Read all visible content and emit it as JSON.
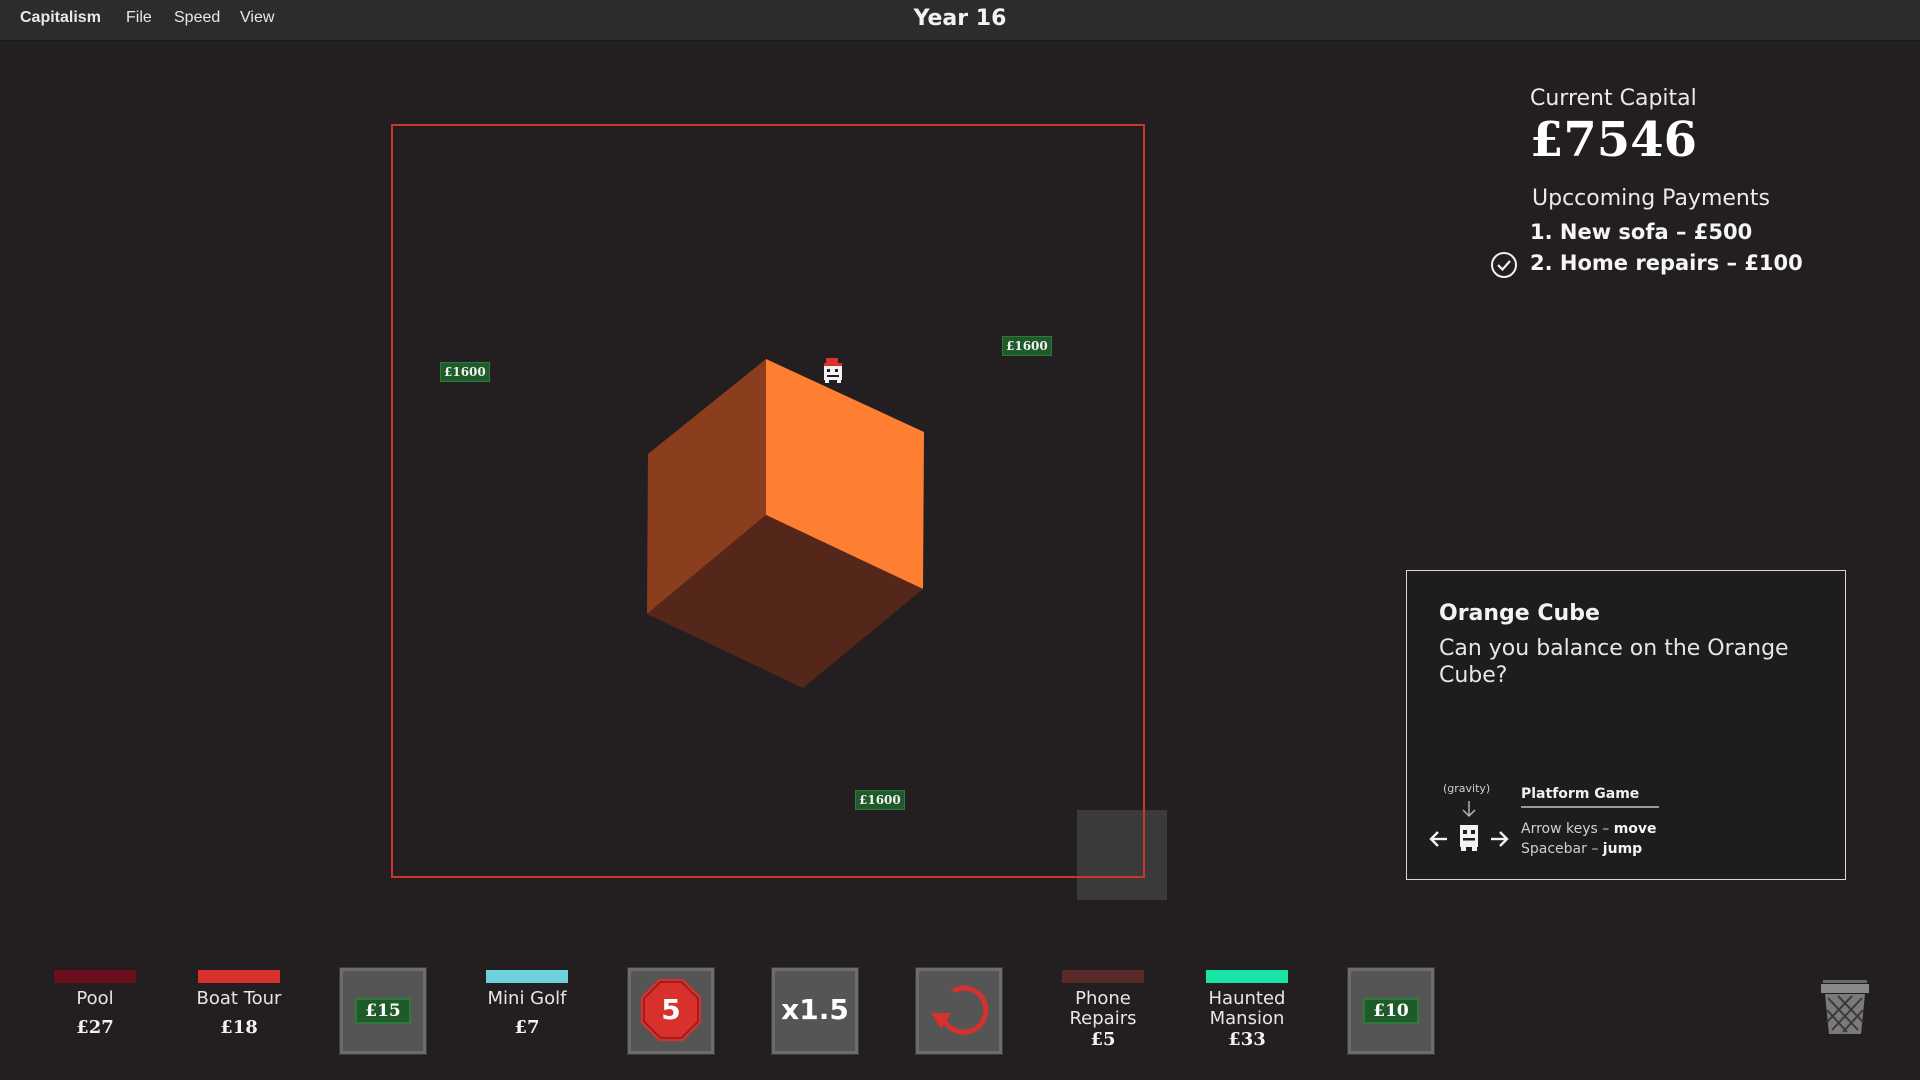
{
  "menu": {
    "app": "Capitalism",
    "file": "File",
    "speed": "Speed",
    "view": "View"
  },
  "header": {
    "year": "Year 16"
  },
  "game": {
    "coins": [
      "£1600",
      "£1600",
      "£1600"
    ],
    "cube_color": "#ff7f32"
  },
  "capital": {
    "label": "Current Capital",
    "value": "£7546",
    "payments_label": "Upccoming Payments",
    "payments": [
      {
        "text": "1. New sofa – £500",
        "checked": false
      },
      {
        "text": "2. Home repairs – £100",
        "checked": true
      }
    ]
  },
  "card": {
    "title": "Orange Cube",
    "description": "Can you balance on the Orange Cube?",
    "gravity": "(gravity)",
    "mode_title": "Platform Game",
    "controls": [
      {
        "key": "Arrow keys",
        "action": "move"
      },
      {
        "key": "Spacebar",
        "action": "jump"
      }
    ]
  },
  "dock": {
    "pool": {
      "name": "Pool",
      "price": "£27",
      "color": "#6b0f1f"
    },
    "boat_tour": {
      "name": "Boat Tour",
      "price": "£18",
      "color": "#d8302c"
    },
    "money_tile_1": {
      "value": "£15"
    },
    "mini_golf": {
      "name": "Mini Golf",
      "price": "£7",
      "color": "#6fd0dc"
    },
    "stop_tile": {
      "value": "5"
    },
    "speed_tile": {
      "value": "x1.5"
    },
    "phone_repairs": {
      "name_line1": "Phone",
      "name_line2": "Repairs",
      "price": "£5",
      "color": "#5a2a2a"
    },
    "haunted_mansion": {
      "name_line1": "Haunted",
      "name_line2": "Mansion",
      "price": "£33",
      "color": "#19e6a6"
    },
    "money_tile_2": {
      "value": "£10"
    }
  },
  "icons": [
    "checkmark-circle-icon",
    "player-icon",
    "arrow-left-icon",
    "arrow-right-icon",
    "gravity-down-arrow-icon",
    "stop-sign-icon",
    "undo-icon",
    "trash-icon"
  ]
}
